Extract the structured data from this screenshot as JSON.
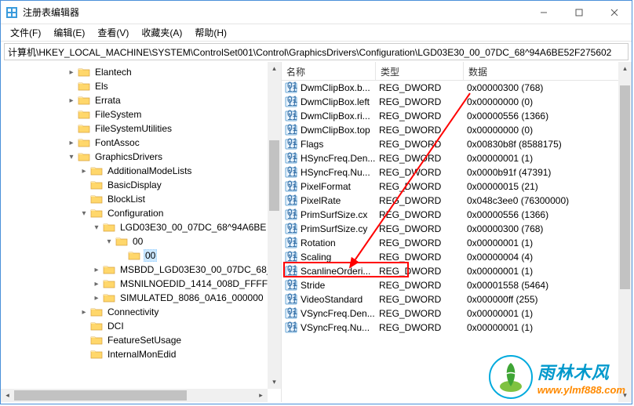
{
  "window": {
    "title": "注册表编辑器"
  },
  "menu": {
    "file": "文件(F)",
    "edit": "编辑(E)",
    "view": "查看(V)",
    "favorites": "收藏夹(A)",
    "help": "帮助(H)"
  },
  "address": "计算机\\HKEY_LOCAL_MACHINE\\SYSTEM\\ControlSet001\\Control\\GraphicsDrivers\\Configuration\\LGD03E30_00_07DC_68^94A6BE52F275602",
  "tree": [
    {
      "indent": 4,
      "exp": "▸",
      "label": "Elantech"
    },
    {
      "indent": 4,
      "exp": "",
      "label": "Els"
    },
    {
      "indent": 4,
      "exp": "▸",
      "label": "Errata"
    },
    {
      "indent": 4,
      "exp": "",
      "label": "FileSystem"
    },
    {
      "indent": 4,
      "exp": "",
      "label": "FileSystemUtilities"
    },
    {
      "indent": 4,
      "exp": "▸",
      "label": "FontAssoc"
    },
    {
      "indent": 4,
      "exp": "▾",
      "label": "GraphicsDrivers"
    },
    {
      "indent": 5,
      "exp": "▸",
      "label": "AdditionalModeLists"
    },
    {
      "indent": 5,
      "exp": "",
      "label": "BasicDisplay"
    },
    {
      "indent": 5,
      "exp": "",
      "label": "BlockList"
    },
    {
      "indent": 5,
      "exp": "▾",
      "label": "Configuration"
    },
    {
      "indent": 6,
      "exp": "▾",
      "label": "LGD03E30_00_07DC_68^94A6BE"
    },
    {
      "indent": 7,
      "exp": "▾",
      "label": "00"
    },
    {
      "indent": 8,
      "exp": "",
      "label": "00",
      "selected": true
    },
    {
      "indent": 6,
      "exp": "▸",
      "label": "MSBDD_LGD03E30_00_07DC_68_"
    },
    {
      "indent": 6,
      "exp": "▸",
      "label": "MSNILNOEDID_1414_008D_FFFF"
    },
    {
      "indent": 6,
      "exp": "▸",
      "label": "SIMULATED_8086_0A16_000000"
    },
    {
      "indent": 5,
      "exp": "▸",
      "label": "Connectivity"
    },
    {
      "indent": 5,
      "exp": "",
      "label": "DCI"
    },
    {
      "indent": 5,
      "exp": "",
      "label": "FeatureSetUsage"
    },
    {
      "indent": 5,
      "exp": "",
      "label": "InternalMonEdid"
    }
  ],
  "columns": {
    "name": "名称",
    "type": "类型",
    "data": "数据"
  },
  "values": [
    {
      "name": "DwmClipBox.b...",
      "type": "REG_DWORD",
      "data": "0x00000300 (768)"
    },
    {
      "name": "DwmClipBox.left",
      "type": "REG_DWORD",
      "data": "0x00000000 (0)"
    },
    {
      "name": "DwmClipBox.ri...",
      "type": "REG_DWORD",
      "data": "0x00000556 (1366)"
    },
    {
      "name": "DwmClipBox.top",
      "type": "REG_DWORD",
      "data": "0x00000000 (0)"
    },
    {
      "name": "Flags",
      "type": "REG_DWORD",
      "data": "0x00830b8f (8588175)"
    },
    {
      "name": "HSyncFreq.Den...",
      "type": "REG_DWORD",
      "data": "0x00000001 (1)"
    },
    {
      "name": "HSyncFreq.Nu...",
      "type": "REG_DWORD",
      "data": "0x0000b91f (47391)"
    },
    {
      "name": "PixelFormat",
      "type": "REG_DWORD",
      "data": "0x00000015 (21)"
    },
    {
      "name": "PixelRate",
      "type": "REG_DWORD",
      "data": "0x048c3ee0 (76300000)"
    },
    {
      "name": "PrimSurfSize.cx",
      "type": "REG_DWORD",
      "data": "0x00000556 (1366)"
    },
    {
      "name": "PrimSurfSize.cy",
      "type": "REG_DWORD",
      "data": "0x00000300 (768)"
    },
    {
      "name": "Rotation",
      "type": "REG_DWORD",
      "data": "0x00000001 (1)"
    },
    {
      "name": "Scaling",
      "type": "REG_DWORD",
      "data": "0x00000004 (4)"
    },
    {
      "name": "ScanlineOrderi...",
      "type": "REG_DWORD",
      "data": "0x00000001 (1)"
    },
    {
      "name": "Stride",
      "type": "REG_DWORD",
      "data": "0x00001558 (5464)"
    },
    {
      "name": "VideoStandard",
      "type": "REG_DWORD",
      "data": "0x000000ff (255)"
    },
    {
      "name": "VSyncFreq.Den...",
      "type": "REG_DWORD",
      "data": "0x00000001 (1)"
    },
    {
      "name": "VSyncFreq.Nu...",
      "type": "REG_DWORD",
      "data": "0x00000001 (1)"
    }
  ],
  "watermark": {
    "cn": "雨林木风",
    "url": "www.ylmf888.com"
  }
}
